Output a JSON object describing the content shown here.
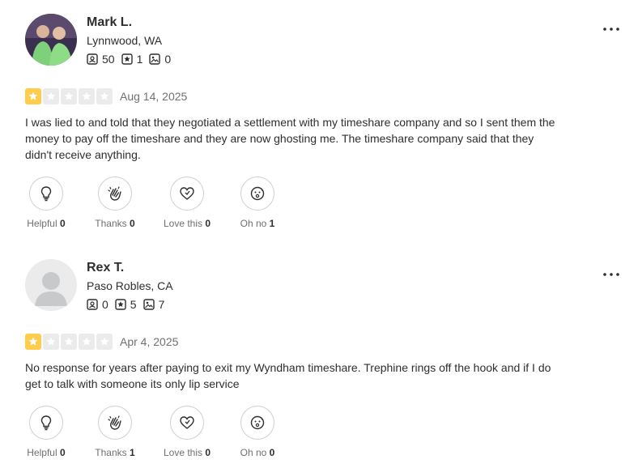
{
  "colors": {
    "star_filled": "#ffcc4b",
    "star_empty": "#ebebeb",
    "text": "#2d2e2f",
    "muted": "#6e7072"
  },
  "reviews": [
    {
      "name": "Mark L.",
      "location": "Lynnwood, WA",
      "reviews_count": "50",
      "friends_count": "1",
      "photos_count": "0",
      "rating": 1,
      "date": "Aug 14, 2025",
      "text": "I was lied to and told that they negotiated a settlement with my timeshare company and so I sent them the money to pay off the timeshare and they are now ghosting me. The timeshare company said that they didn't receive anything.",
      "reactions": [
        {
          "label": "Helpful",
          "count": "0",
          "icon": "lightbulb-icon"
        },
        {
          "label": "Thanks",
          "count": "0",
          "icon": "clapping-hands-icon"
        },
        {
          "label": "Love this",
          "count": "0",
          "icon": "heart-icon"
        },
        {
          "label": "Oh no",
          "count": "1",
          "icon": "sad-face-icon"
        }
      ]
    },
    {
      "name": "Rex T.",
      "location": "Paso Robles, CA",
      "reviews_count": "0",
      "friends_count": "5",
      "photos_count": "7",
      "rating": 1,
      "date": "Apr 4, 2025",
      "text": "No response for years after paying to exit my Wyndham timeshare. Trephine rings off the hook and if I do get to talk with someone its only lip service",
      "reactions": [
        {
          "label": "Helpful",
          "count": "0",
          "icon": "lightbulb-icon"
        },
        {
          "label": "Thanks",
          "count": "1",
          "icon": "clapping-hands-icon"
        },
        {
          "label": "Love this",
          "count": "0",
          "icon": "heart-icon"
        },
        {
          "label": "Oh no",
          "count": "0",
          "icon": "sad-face-icon"
        }
      ]
    }
  ]
}
